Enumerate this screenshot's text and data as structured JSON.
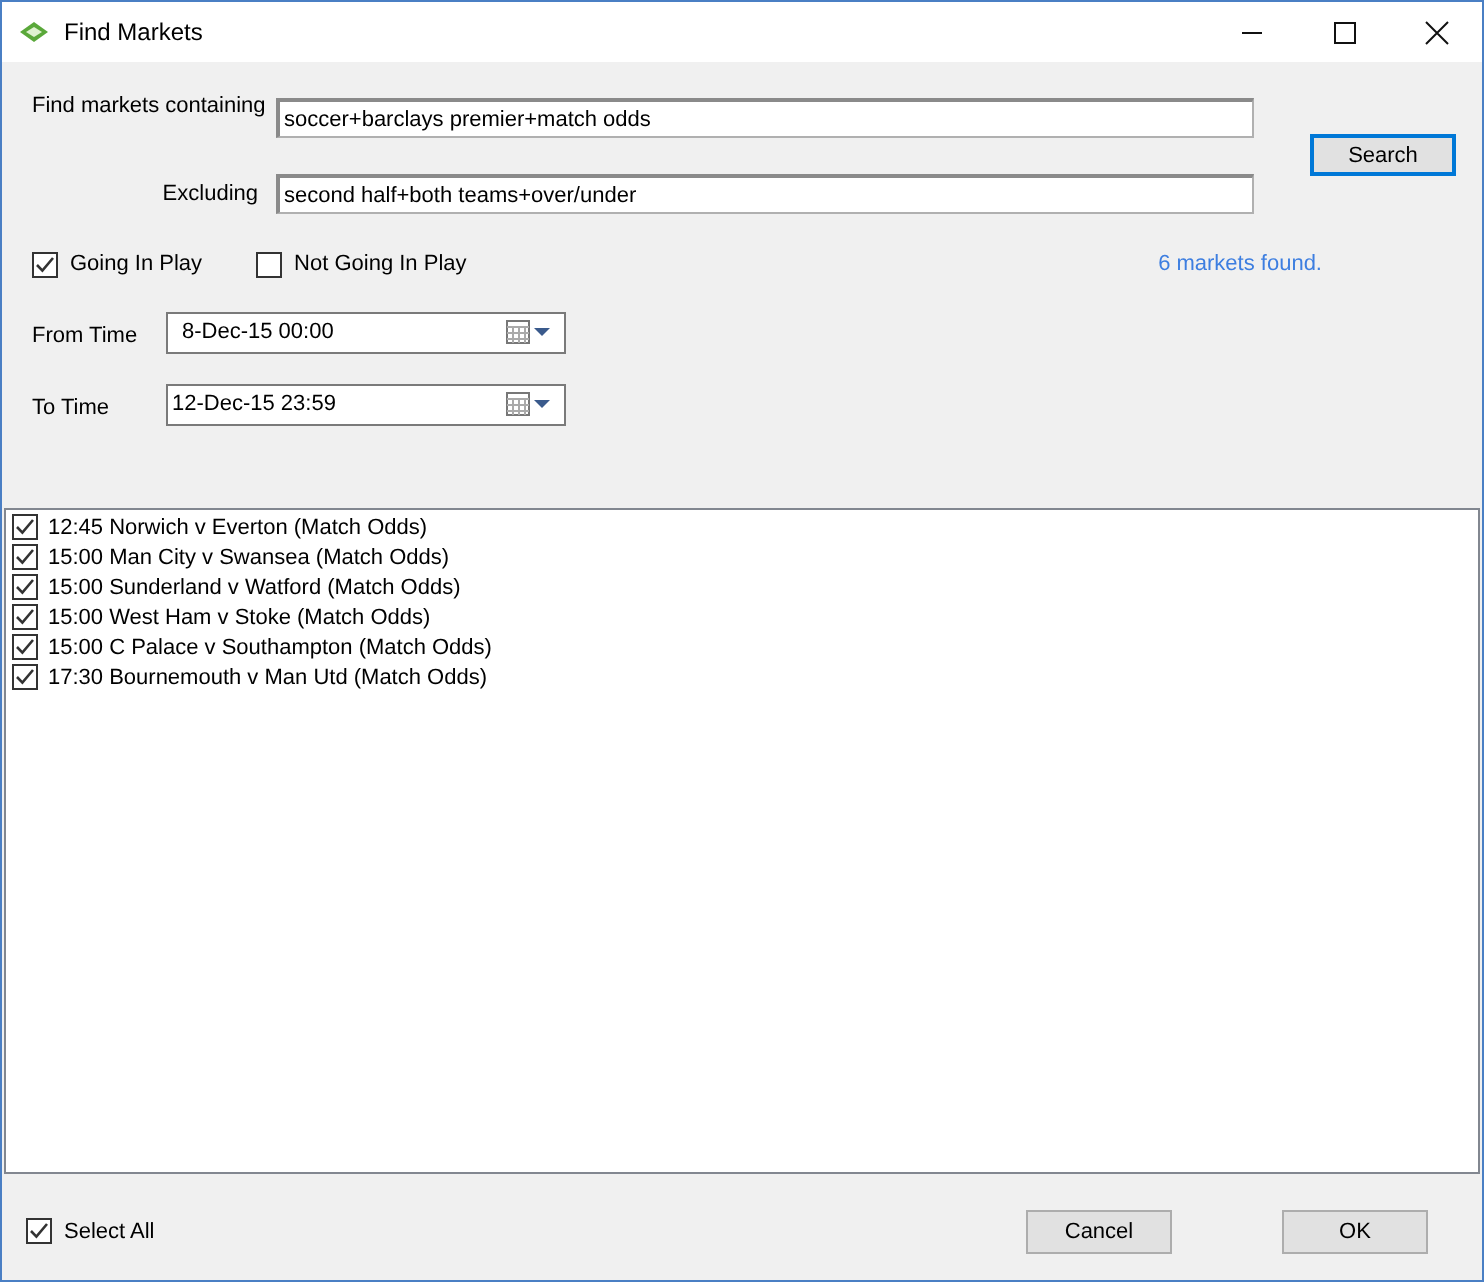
{
  "window": {
    "title": "Find Markets"
  },
  "search": {
    "containing_label": "Find markets containing",
    "containing_value": "soccer+barclays premier+match odds",
    "excluding_label": "Excluding",
    "excluding_value": "second half+both teams+over/under",
    "button": "Search"
  },
  "filters": [
    {
      "label": "Going In Play",
      "checked": true
    },
    {
      "label": "Not Going In Play",
      "checked": false
    }
  ],
  "result_count": "6 markets found.",
  "times": [
    {
      "label": "From Time",
      "value": "8-Dec-15 00:00"
    },
    {
      "label": "To Time",
      "value": "12-Dec-15 23:59"
    }
  ],
  "markets": [
    {
      "label": "12:45 Norwich v Everton (Match Odds)",
      "checked": true
    },
    {
      "label": "15:00 Man City v Swansea (Match Odds)",
      "checked": true
    },
    {
      "label": "15:00 Sunderland v Watford (Match Odds)",
      "checked": true
    },
    {
      "label": "15:00 West Ham v Stoke (Match Odds)",
      "checked": true
    },
    {
      "label": "15:00 C Palace v Southampton (Match Odds)",
      "checked": true
    },
    {
      "label": "17:30 Bournemouth v Man Utd (Match Odds)",
      "checked": true
    }
  ],
  "select_all": {
    "label": "Select All",
    "checked": true
  },
  "buttons": [
    "Cancel",
    "OK"
  ]
}
